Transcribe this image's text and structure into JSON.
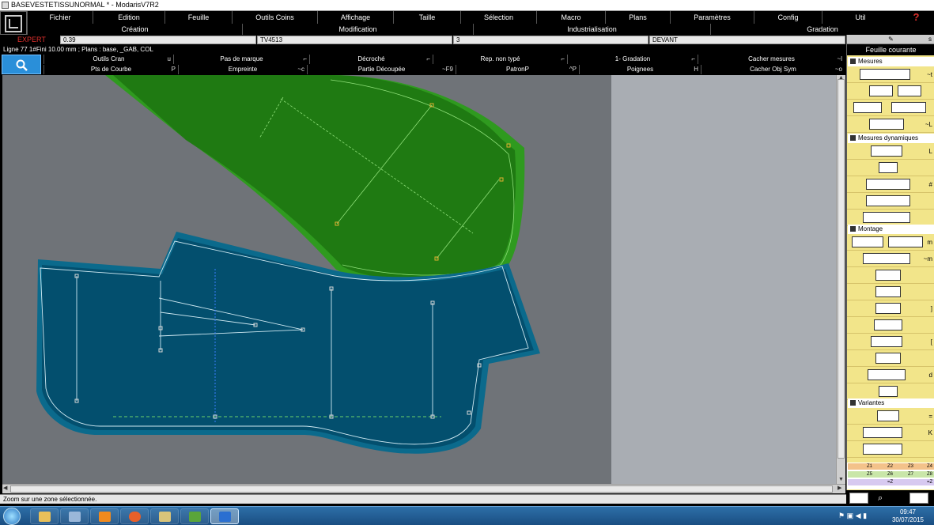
{
  "window": {
    "title": "BASEVESTETISSUNORMAL * - ModarisV7R2"
  },
  "menu": [
    {
      "label": "Fichier"
    },
    {
      "label": "Edition"
    },
    {
      "label": "Feuille"
    },
    {
      "label": "Outils Coins"
    },
    {
      "label": "Affichage"
    },
    {
      "label": "Taille"
    },
    {
      "label": "Sélection"
    },
    {
      "label": "Macro"
    },
    {
      "label": "Plans"
    },
    {
      "label": "Paramètres"
    },
    {
      "label": "Config"
    },
    {
      "label": "Util"
    }
  ],
  "help_icon": "?",
  "submenu": [
    {
      "label": "Création"
    },
    {
      "label": "Modification"
    },
    {
      "label": "Industrialisation"
    },
    {
      "label": "Gradation"
    }
  ],
  "info": {
    "mode": "EXPERT",
    "field1": "0.39",
    "field2": "TV4513",
    "field3": "3",
    "field4": "DEVANT"
  },
  "statusline": "Ligne 77 1#Fini 10.00 mm ;    Plans :  base, _GAB, COL",
  "tools_row1": [
    {
      "label": "Outils Cran",
      "shortcut": "u"
    },
    {
      "label": "Pas de marque",
      "shortcut": "⌐"
    },
    {
      "label": "Décroché",
      "shortcut": "⌐"
    },
    {
      "label": "Rep. non typé",
      "shortcut": "⌐"
    },
    {
      "label": "1- Gradation",
      "shortcut": "⌐"
    },
    {
      "label": "Cacher mesures",
      "shortcut": "~l"
    }
  ],
  "tools_row2": [
    {
      "label": "Pts de Courbe",
      "shortcut": "P"
    },
    {
      "label": "Empreinte",
      "shortcut": "~c"
    },
    {
      "label": "Partie Découpée",
      "shortcut": "~F9"
    },
    {
      "label": "PatronP",
      "shortcut": "^P"
    },
    {
      "label": "Poignees",
      "shortcut": "H"
    },
    {
      "label": "Cacher Obj Sym",
      "shortcut": "~o"
    }
  ],
  "status_message": "Zoom sur une zone sélectionnée.",
  "right_panel": {
    "head_shortcut": "s",
    "title": "Feuille courante",
    "sections": [
      {
        "label": "Mesures"
      },
      {
        "label": "Mesures dynamiques"
      },
      {
        "label": "Montage"
      },
      {
        "label": "Variantes"
      }
    ],
    "keys": {
      "r1": "~t",
      "r3": "~L",
      "r4": "L",
      "r6": "#",
      "r8": "m",
      "r9": "~m",
      "r12": "]",
      "r14": "[",
      "r16": "d",
      "r18": "=",
      "r19": "K"
    }
  },
  "gradation_rows": [
    {
      "a": "Z1",
      "b": "Z2",
      "c": "Z3",
      "d": "Z4",
      "color": "#f3c28a"
    },
    {
      "a": "Z5",
      "b": "Z6",
      "c": "Z7",
      "d": "Z8",
      "color": "#c9e6a8"
    },
    {
      "a": "",
      "b": "=Z",
      "c": "",
      "d": "=Z",
      "color": "#d7c9f0"
    }
  ],
  "clock": {
    "time": "09:47",
    "date": "30/07/2015"
  },
  "colors": {
    "canvas": "#6f7378",
    "canvas_right": "#a9adb3",
    "piece_green": "#1f7a12",
    "piece_green_seam": "#2f9a1f",
    "piece_blue": "#034f6e",
    "piece_blue_seam": "#0b6a8c",
    "panel": "#f2e58a",
    "expert": "#e0302c"
  },
  "taskbar_apps": [
    {
      "name": "explorer-icon"
    },
    {
      "name": "media-icon"
    },
    {
      "name": "vlc-icon"
    },
    {
      "name": "firefox-icon"
    },
    {
      "name": "paint-icon"
    },
    {
      "name": "modaris-icon"
    },
    {
      "name": "app-icon"
    }
  ]
}
